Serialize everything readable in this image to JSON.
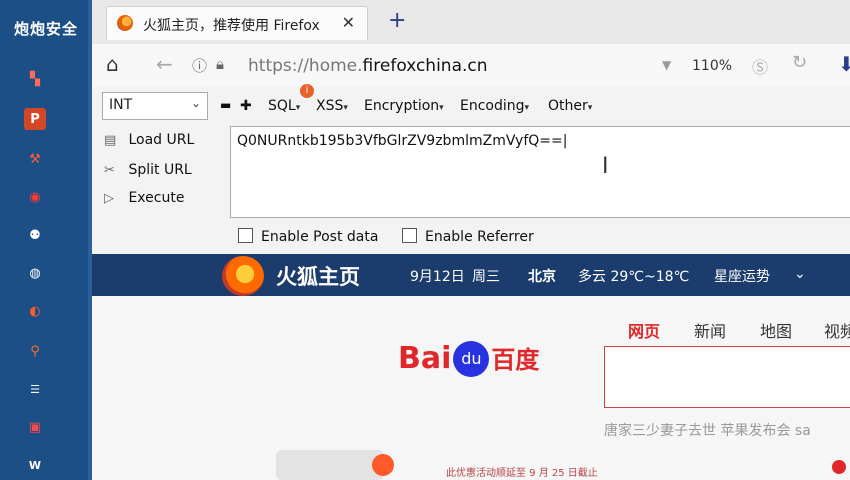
{
  "sidebar": {
    "title": "炮炮安全",
    "icons": [
      "slides-icon",
      "powerpoint-icon",
      "tools-icon",
      "record-icon",
      "network-icon",
      "globe-icon",
      "firefox-icon",
      "search-icon",
      "doc-icon",
      "gift-icon",
      "word-icon"
    ]
  },
  "browser": {
    "tab_title": "火狐主页，推荐使用 Firefox",
    "tab_close": "✕",
    "new_tab": "+",
    "url_prefix": "https://home.",
    "url_domain": "firefoxchina.cn",
    "zoom": "110%"
  },
  "hackbar": {
    "select_value": "INT",
    "menus": [
      "SQL",
      "XSS",
      "Encryption",
      "Encoding",
      "Other"
    ],
    "load_url": "Load URL",
    "split_url": "Split URL",
    "execute": "Execute",
    "text": "Q0NURntkb195b3VfbGlrZV9zbmlmZmVyfQ==",
    "enable_post": "Enable Post data",
    "enable_referrer": "Enable Referrer",
    "badge": "i"
  },
  "page": {
    "brand": "火狐主页",
    "date": "9月12日",
    "weekday": "周三",
    "city": "北京",
    "weather": "多云 29℃~18℃",
    "horoscope": "星座运势",
    "search_nav": [
      "网页",
      "新闻",
      "地图",
      "视频"
    ],
    "baidu_bai": "Bai",
    "baidu_du": "du",
    "baidu_cn": "百度",
    "hot_searches": "唐家三少妻子去世   苹果发布会   sa",
    "promo": "此优惠活动顺延至 9 月 25 日截止"
  },
  "colors": {
    "taskbar": "#1c4f86",
    "header": "#1c3c6e",
    "baidu_red": "#e1272a",
    "baidu_blue": "#2932e1"
  }
}
